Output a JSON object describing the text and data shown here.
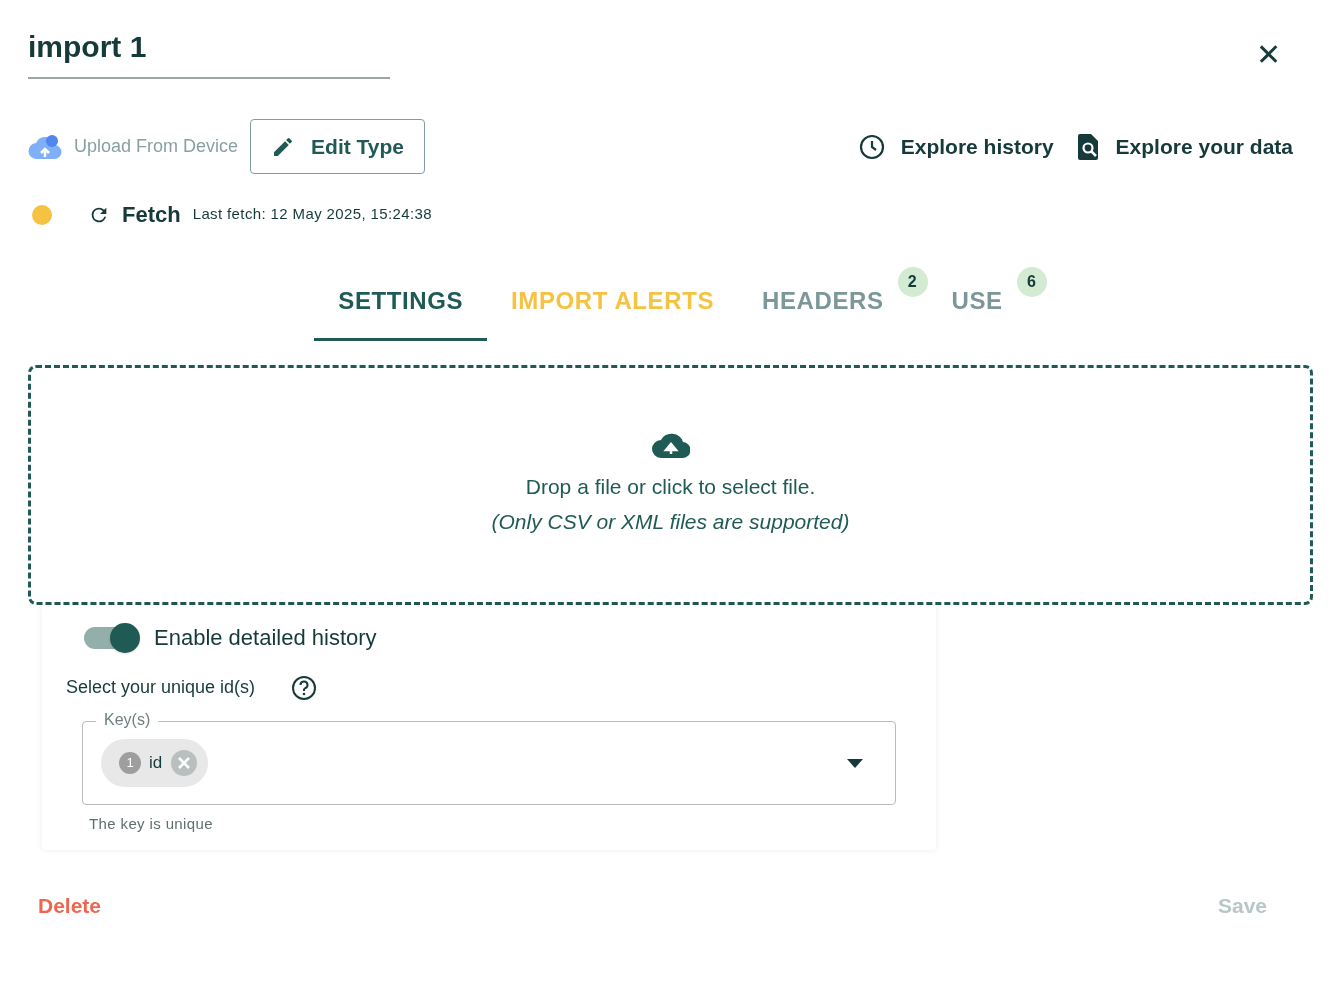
{
  "title": {
    "value": "import 1"
  },
  "close_label": "✕",
  "toolbar": {
    "upload": "Upload From Device",
    "edit_type": "Edit Type",
    "explore_history": "Explore history",
    "explore_data": "Explore your data"
  },
  "fetch": {
    "status": {
      "color": "#f5c242"
    },
    "label": "Fetch",
    "last_fetch": "Last fetch: 12 May 2025, 15:24:38"
  },
  "tabs": [
    {
      "label": "SETTINGS",
      "selected": true,
      "warning": false
    },
    {
      "label": "IMPORT ALERTS",
      "selected": false,
      "warning": true
    },
    {
      "label": "HEADERS",
      "selected": false,
      "warning": false,
      "badge": "2"
    },
    {
      "label": "USE",
      "selected": false,
      "warning": false,
      "badge": "6"
    }
  ],
  "dropzone": {
    "line_1": "Drop a file or click to select file.",
    "line_2": "(Only CSV or XML files are supported)"
  },
  "settings": {
    "history_toggle": {
      "label": "Enable detailed history",
      "on": true
    },
    "unique_label": "Select your unique id(s)",
    "keys_field": {
      "label": "Key(s)",
      "chips": [
        {
          "index": "1",
          "value": "id"
        }
      ],
      "helper": "The key is unique"
    }
  },
  "footer": {
    "delete": "Delete",
    "save": {
      "label": "Save",
      "disabled": true
    }
  }
}
